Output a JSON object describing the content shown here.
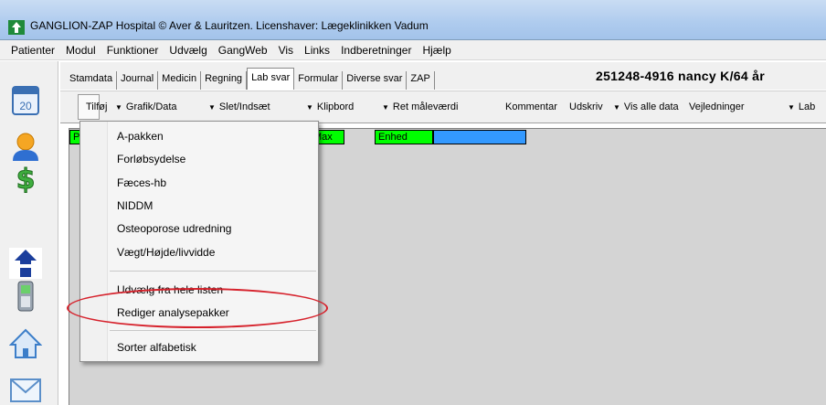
{
  "window": {
    "title": "GANGLION-ZAP Hospital  © Aver & Lauritzen. Licenshaver: Lægeklinikken Vadum",
    "app_icon": "ganglion-zap-icon"
  },
  "menubar": {
    "items": [
      "Patienter",
      "Modul",
      "Funktioner",
      "Udvælg",
      "GangWeb",
      "Vis",
      "Links",
      "Indberetninger",
      "Hjælp"
    ]
  },
  "tabs": {
    "items": [
      "Stamdata",
      "Journal",
      "Medicin",
      "Regning",
      "Lab svar",
      "Formular",
      "Diverse svar",
      "ZAP"
    ],
    "active": "Lab svar"
  },
  "patient": {
    "header": "251248-4916 nancy K/64 år"
  },
  "toolbar": {
    "items": [
      "Tilføj",
      "Grafik/Data",
      "Slet/Indsæt",
      "Klipbord",
      "Ret måleværdi",
      "Kommentar",
      "Udskriv",
      "Vis alle data",
      "Vejledninger",
      "Lab"
    ]
  },
  "grid": {
    "headers": [
      "P",
      "Max",
      "Enhed"
    ],
    "header_color": "#00ff00",
    "selected_color": "#3399ff"
  },
  "dropdown": {
    "group1": [
      "A-pakken",
      "Forløbsydelse",
      "Fæces-hb",
      "NIDDM",
      "Osteoporose udredning",
      "Vægt/Højde/livvidde"
    ],
    "group2": [
      "Udvælg fra hele listen",
      "Rediger analysepakker"
    ],
    "group3": [
      "Sorter alfabetisk"
    ]
  },
  "annotation": {
    "color": "#d6222c"
  },
  "sidebar_icons": [
    "calendar-icon",
    "user-icon",
    "dollar-icon",
    "ganglion-logo-icon",
    "phone-icon",
    "home-icon",
    "mail-icon"
  ],
  "calendar_day": "20"
}
